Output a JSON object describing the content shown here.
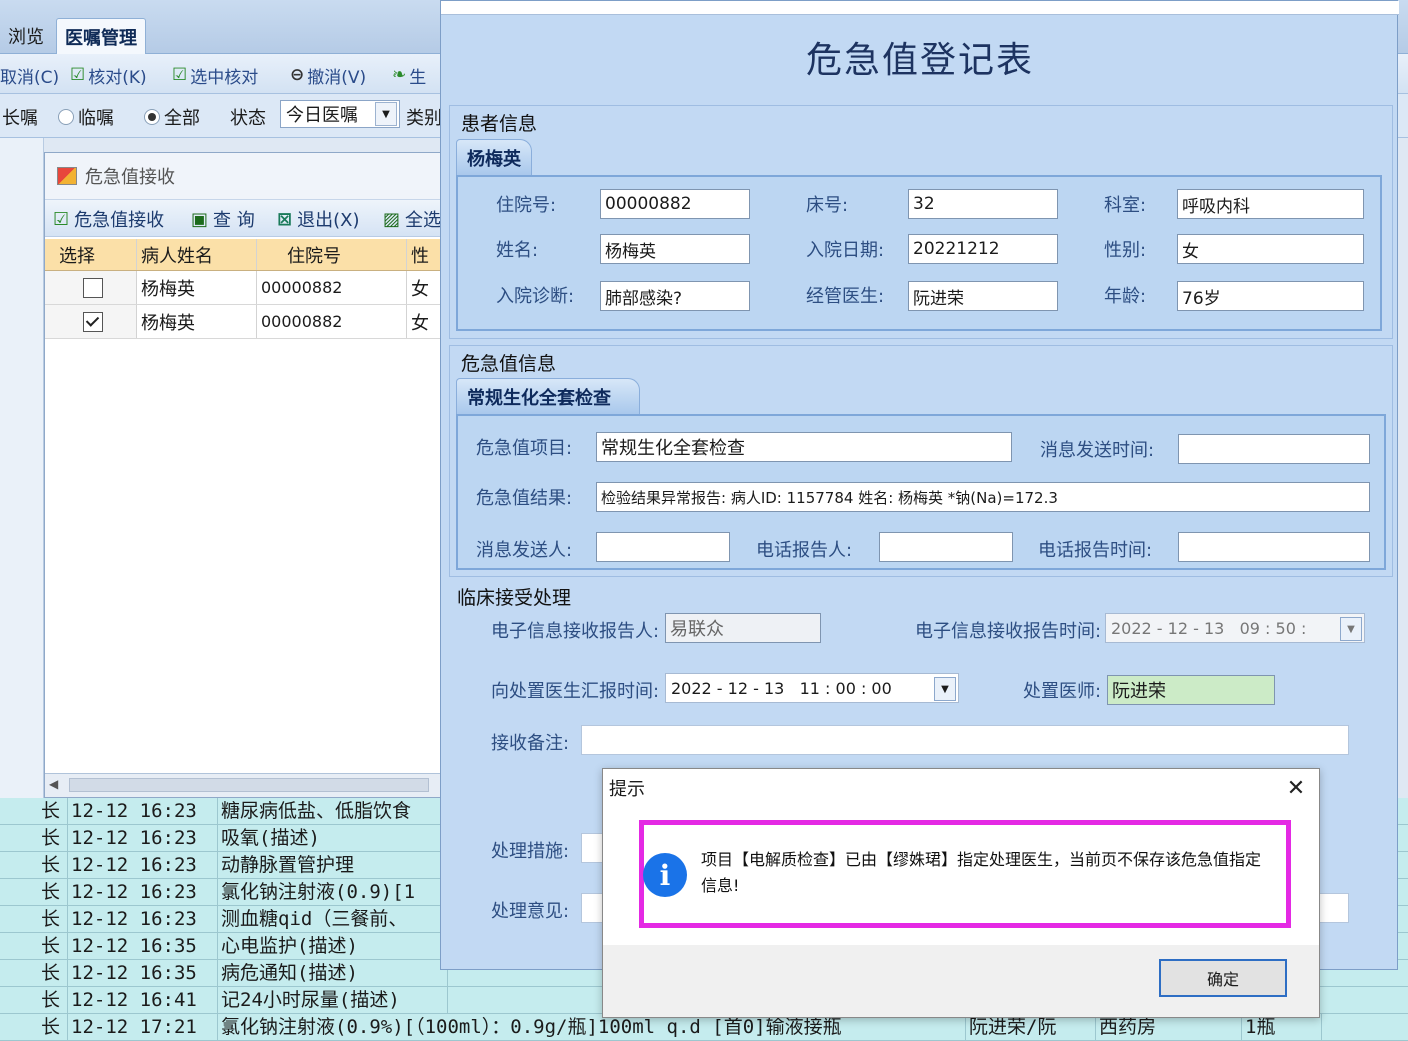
{
  "app": {
    "tabs": [
      {
        "label": "浏览"
      },
      {
        "label": "医嘱管理"
      }
    ],
    "toolbar": [
      {
        "label": "取消(C)",
        "icon": "cancel-icon"
      },
      {
        "label": "核对(K)",
        "icon": "check-icon"
      },
      {
        "label": "选中核对",
        "icon": "check-icon"
      },
      {
        "label": "撤消(V)",
        "icon": "undo-icon"
      },
      {
        "label": "生",
        "icon": "generate-icon"
      }
    ],
    "filter": {
      "long_label": "长嘱",
      "temp_label": "临嘱",
      "all_label": "全部",
      "status_label": "状态",
      "status_value": "今日医嘱",
      "category_label": "类别"
    },
    "orders": [
      {
        "type": "长",
        "time": "12-12 16:23",
        "content": "糖尿病低盐、低脂饮食"
      },
      {
        "type": "长",
        "time": "12-12 16:23",
        "content": "吸氧(描述)"
      },
      {
        "type": "长",
        "time": "12-12 16:23",
        "content": "动静脉置管护理"
      },
      {
        "type": "长",
        "time": "12-12 16:23",
        "content": "氯化钠注射液(0.9)[1"
      },
      {
        "type": "长",
        "time": "12-12 16:23",
        "content": "测血糖qid（三餐前、"
      },
      {
        "type": "长",
        "time": "12-12 16:35",
        "content": "心电监护(描述)"
      },
      {
        "type": "长",
        "time": "12-12 16:35",
        "content": "病危通知(描述)"
      },
      {
        "type": "长",
        "time": "12-12 16:41",
        "content": "记24小时尿量(描述)"
      },
      {
        "type": "长",
        "time": "12-12 17:21",
        "content": "氯化钠注射液(0.9%)[（100ml）：0.9g/瓶]100ml  q.d [首0]输液接瓶",
        "doctor": "阮进荣/阮",
        "pharmacy": "西药房",
        "qty": "1瓶"
      }
    ]
  },
  "receive": {
    "title": "危急值接收",
    "tools": [
      "危急值接收",
      "查 询",
      "退出(X)",
      "全选"
    ],
    "columns": [
      "选择",
      "病人姓名",
      "住院号",
      "性"
    ],
    "rows": [
      {
        "checked": false,
        "name": "杨梅英",
        "id": "00000882",
        "sex": "女"
      },
      {
        "checked": true,
        "name": "杨梅英",
        "id": "00000882",
        "sex": "女"
      }
    ]
  },
  "form": {
    "title": "危急值登记表",
    "patient_section": "患者信息",
    "patient_tab": "杨梅英",
    "patient": {
      "inpatient_no_label": "住院号:",
      "inpatient_no": "00000882",
      "bed_label": "床号:",
      "bed": "32",
      "dept_label": "科室:",
      "dept": "呼吸内科",
      "name_label": "姓名:",
      "name": "杨梅英",
      "admit_date_label": "入院日期:",
      "admit_date": "20221212",
      "sex_label": "性别:",
      "sex": "女",
      "diagnosis_label": "入院诊断:",
      "diagnosis": "肺部感染?",
      "doctor_label": "经管医生:",
      "doctor": "阮进荣",
      "age_label": "年龄:",
      "age": "76岁"
    },
    "critical_section": "危急值信息",
    "critical_tab": "常规生化全套检查",
    "critical": {
      "item_label": "危急值项目:",
      "item": "常规生化全套检查",
      "send_time_label": "消息发送时间:",
      "send_time": "",
      "result_label": "危急值结果:",
      "result": "检验结果异常报告: 病人ID: 1157784 姓名: 杨梅英 *钠(Na)=172.3",
      "sender_label": "消息发送人:",
      "sender": "",
      "phone_reporter_label": "电话报告人:",
      "phone_reporter": "",
      "phone_time_label": "电话报告时间:",
      "phone_time": ""
    },
    "clinical_section": "临床接受处理",
    "clinical": {
      "receiver_label": "电子信息接收报告人:",
      "receiver": "易联众",
      "receive_time_label": "电子信息接收报告时间:",
      "receive_time": "2022 - 12 - 13   09 : 50 :",
      "report_time_label": "向处置医生汇报时间:",
      "report_time": "2022 - 12 - 13   11 : 00 : 00",
      "handler_label": "处置医师:",
      "handler": "阮进荣",
      "remark_label": "接收备注:",
      "remark": "",
      "measure_label": "处理措施:",
      "opinion_label": "处理意见:"
    }
  },
  "message": {
    "title": "提示",
    "text": "项目【电解质检查】已由【缪姝珺】指定处理医生，当前页不保存该危急值指定信息!",
    "ok": "确定"
  },
  "colors": {
    "highlight": "#e429e4",
    "info": "#1a73e8",
    "form_bg": "#c2d9f3"
  }
}
